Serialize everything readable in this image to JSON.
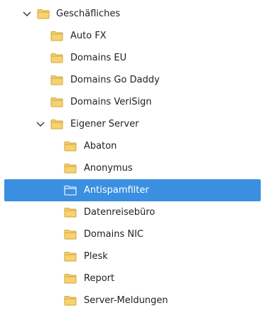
{
  "colors": {
    "selection": "#3b8fe0",
    "folder_fill": "#f6d36f",
    "folder_stroke": "#d1a43b",
    "folder_selected_fill": "#3b8fe0",
    "folder_selected_stroke": "#ffffff"
  },
  "tree": {
    "items": [
      {
        "label": "Geschäfliches",
        "level": 0,
        "expanded": true,
        "icon": "folder-icon"
      },
      {
        "label": "Auto FX",
        "level": 1,
        "icon": "folder-icon"
      },
      {
        "label": "Domains EU",
        "level": 1,
        "icon": "folder-icon"
      },
      {
        "label": "Domains Go Daddy",
        "level": 1,
        "icon": "folder-icon"
      },
      {
        "label": "Domains VeriSign",
        "level": 1,
        "icon": "folder-icon"
      },
      {
        "label": "Eigener Server",
        "level": 1,
        "expanded": true,
        "icon": "folder-icon"
      },
      {
        "label": "Abaton",
        "level": 2,
        "icon": "folder-icon"
      },
      {
        "label": "Anonymus",
        "level": 2,
        "icon": "folder-icon"
      },
      {
        "label": "Antispamfilter",
        "level": 2,
        "selected": true,
        "icon": "folder-icon"
      },
      {
        "label": "Datenreisebüro",
        "level": 2,
        "icon": "folder-icon"
      },
      {
        "label": "Domains NIC",
        "level": 2,
        "icon": "folder-icon"
      },
      {
        "label": "Plesk",
        "level": 2,
        "icon": "folder-icon"
      },
      {
        "label": "Report",
        "level": 2,
        "icon": "folder-icon"
      },
      {
        "label": "Server-Meldungen",
        "level": 2,
        "icon": "folder-icon"
      }
    ]
  }
}
